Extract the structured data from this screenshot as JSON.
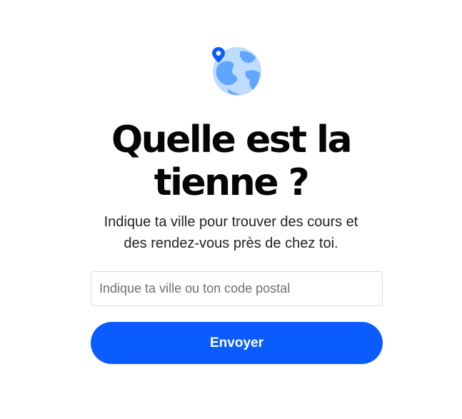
{
  "icon": {
    "name": "globe-location-icon",
    "colors": {
      "ocean": "#bfdcff",
      "land": "#5fa6ff",
      "pin": "#0a5cff"
    }
  },
  "heading": {
    "line1": "Quelle est la",
    "line2": "tienne ?"
  },
  "description": {
    "line1": "Indique ta ville pour trouver des cours et",
    "line2": "des rendez-vous près de chez toi."
  },
  "form": {
    "city_placeholder": "Indique ta ville ou ton code postal",
    "city_value": "",
    "submit_label": "Envoyer"
  },
  "colors": {
    "accent": "#0a5cff",
    "input_border": "#dcdcdc",
    "placeholder": "#6f6f6f"
  }
}
